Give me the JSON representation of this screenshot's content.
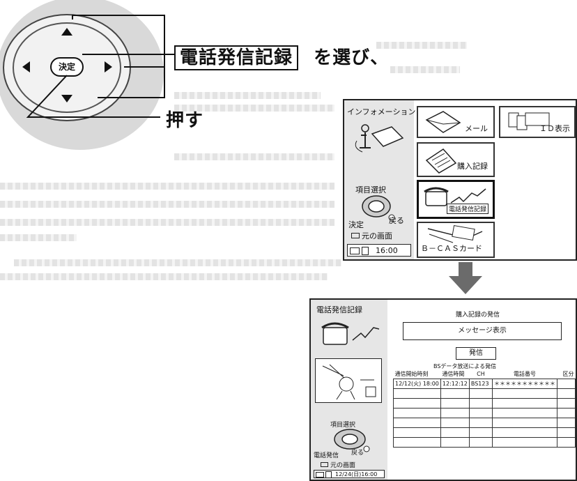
{
  "instruction": {
    "menu_item": "電話発信記録",
    "select_suffix": "を選び、",
    "press": "押す"
  },
  "remote": {
    "enter_label": "決定"
  },
  "menu_screen": {
    "info_label": "インフォメーション",
    "item_select": "項目選択",
    "decide": "決定",
    "back": "戻る",
    "original_screen": "元の画面",
    "time": "16:00",
    "tiles": {
      "mail": "メール",
      "id_display": "ＩＤ表示",
      "purchase_record": "購入記録",
      "call_record": "電話発信記録",
      "bcas_card": "Ｂ－ＣＡＳカード"
    }
  },
  "call_screen": {
    "title": "電話発信記録",
    "item_select": "項目選択",
    "call": "電話発信",
    "back": "戻る",
    "original_screen": "元の画面",
    "datetime": "12/24(日)16:00",
    "purchase_call": "購入記録の発信",
    "message_display": "メッセージ表示",
    "send_button": "発信",
    "bs_caption": "BSデータ放送による発信",
    "columns": [
      "通信開始時刻",
      "通信時間",
      "CH",
      "電話番号",
      "区分"
    ],
    "rows": [
      [
        "12/12(火) 18:00",
        "12:12:12",
        "BS123",
        "＊＊＊＊＊＊＊＊＊＊＊",
        ""
      ],
      [
        "",
        "",
        "",
        "",
        ""
      ],
      [
        "",
        "",
        "",
        "",
        ""
      ],
      [
        "",
        "",
        "",
        "",
        ""
      ],
      [
        "",
        "",
        "",
        "",
        ""
      ],
      [
        "",
        "",
        "",
        "",
        ""
      ],
      [
        "",
        "",
        "",
        "",
        ""
      ]
    ]
  },
  "colors": {
    "panel_gray": "#e6e6e6",
    "remote_gray": "#d9d9d9",
    "arrow_gray": "#6b6b6b"
  }
}
